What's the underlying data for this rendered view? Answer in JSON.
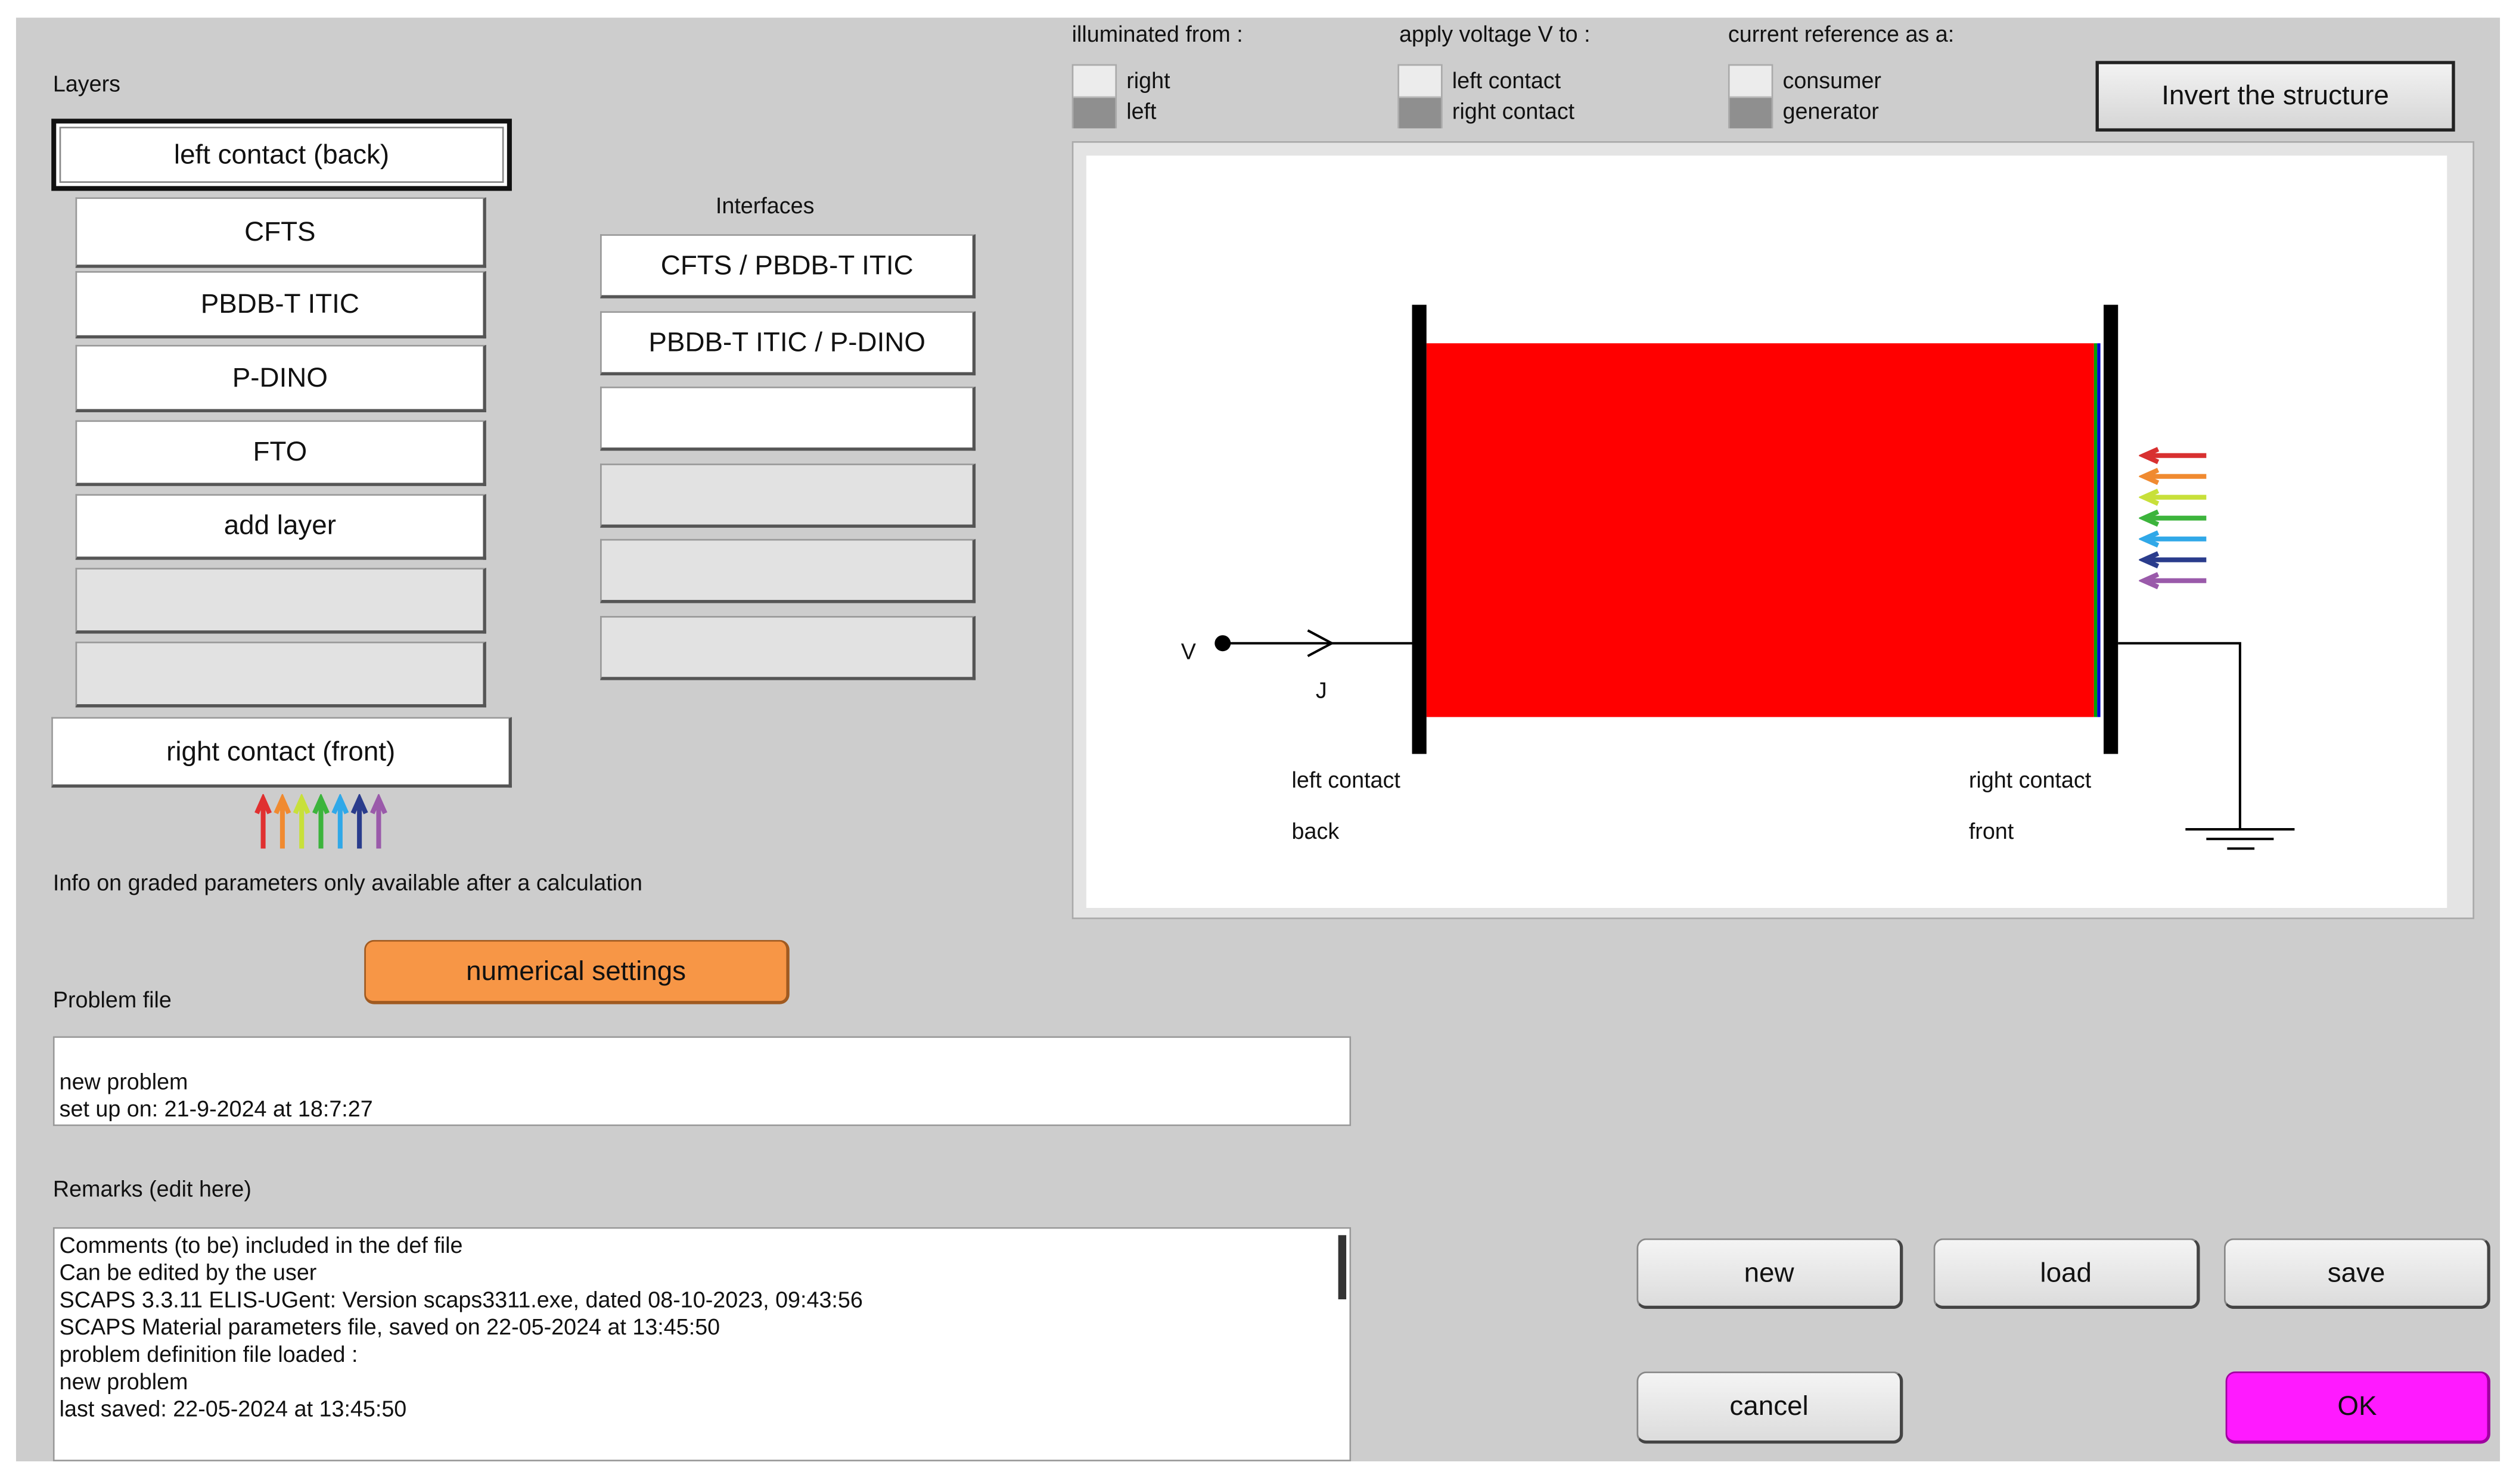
{
  "layers": {
    "title": "Layers",
    "left_contact": "left contact (back)",
    "items": [
      "CFTS",
      "PBDB-T ITIC",
      "P-DINO",
      "FTO",
      "add layer"
    ],
    "right_contact": "right contact (front)"
  },
  "interfaces": {
    "title": "Interfaces",
    "items": [
      "CFTS / PBDB-T ITIC",
      "PBDB-T ITIC / P-DINO"
    ]
  },
  "info_text": "Info on graded parameters only available after a calculation",
  "numerical_settings": "numerical settings",
  "problem_file": {
    "label": "Problem file",
    "lines": [
      "new problem",
      "set up on: 21-9-2024 at 18:7:27"
    ]
  },
  "remarks": {
    "label": "Remarks (edit here)",
    "lines": [
      "Comments (to be) included in the def file",
      "Can be edited by the user",
      "SCAPS 3.3.11 ELIS-UGent: Version scaps3311.exe, dated 08-10-2023, 09:43:56",
      "SCAPS Material parameters file, saved on 22-05-2024 at 13:45:50",
      "problem definition file loaded :",
      "new problem",
      "last saved: 22-05-2024 at 13:45:50"
    ]
  },
  "options": {
    "illuminated": {
      "label": "illuminated from :",
      "opt1": "right",
      "opt2": "left",
      "selected": "left"
    },
    "voltage": {
      "label": "apply voltage V to :",
      "opt1": "left contact",
      "opt2": "right contact",
      "selected": "right contact"
    },
    "current": {
      "label": "current reference as a:",
      "opt1": "consumer",
      "opt2": "generator",
      "selected": "generator"
    }
  },
  "invert_button": "Invert the structure",
  "diagram": {
    "v_label": "V",
    "j_label": "J",
    "left_contact": "left contact",
    "back": "back",
    "right_contact": "right contact",
    "front": "front",
    "layer_color": "#ff0000"
  },
  "buttons": {
    "new": "new",
    "load": "load",
    "save": "save",
    "cancel": "cancel",
    "ok": "OK"
  },
  "colors": {
    "ok": "#ff1aff",
    "numerical": "#f79646"
  }
}
